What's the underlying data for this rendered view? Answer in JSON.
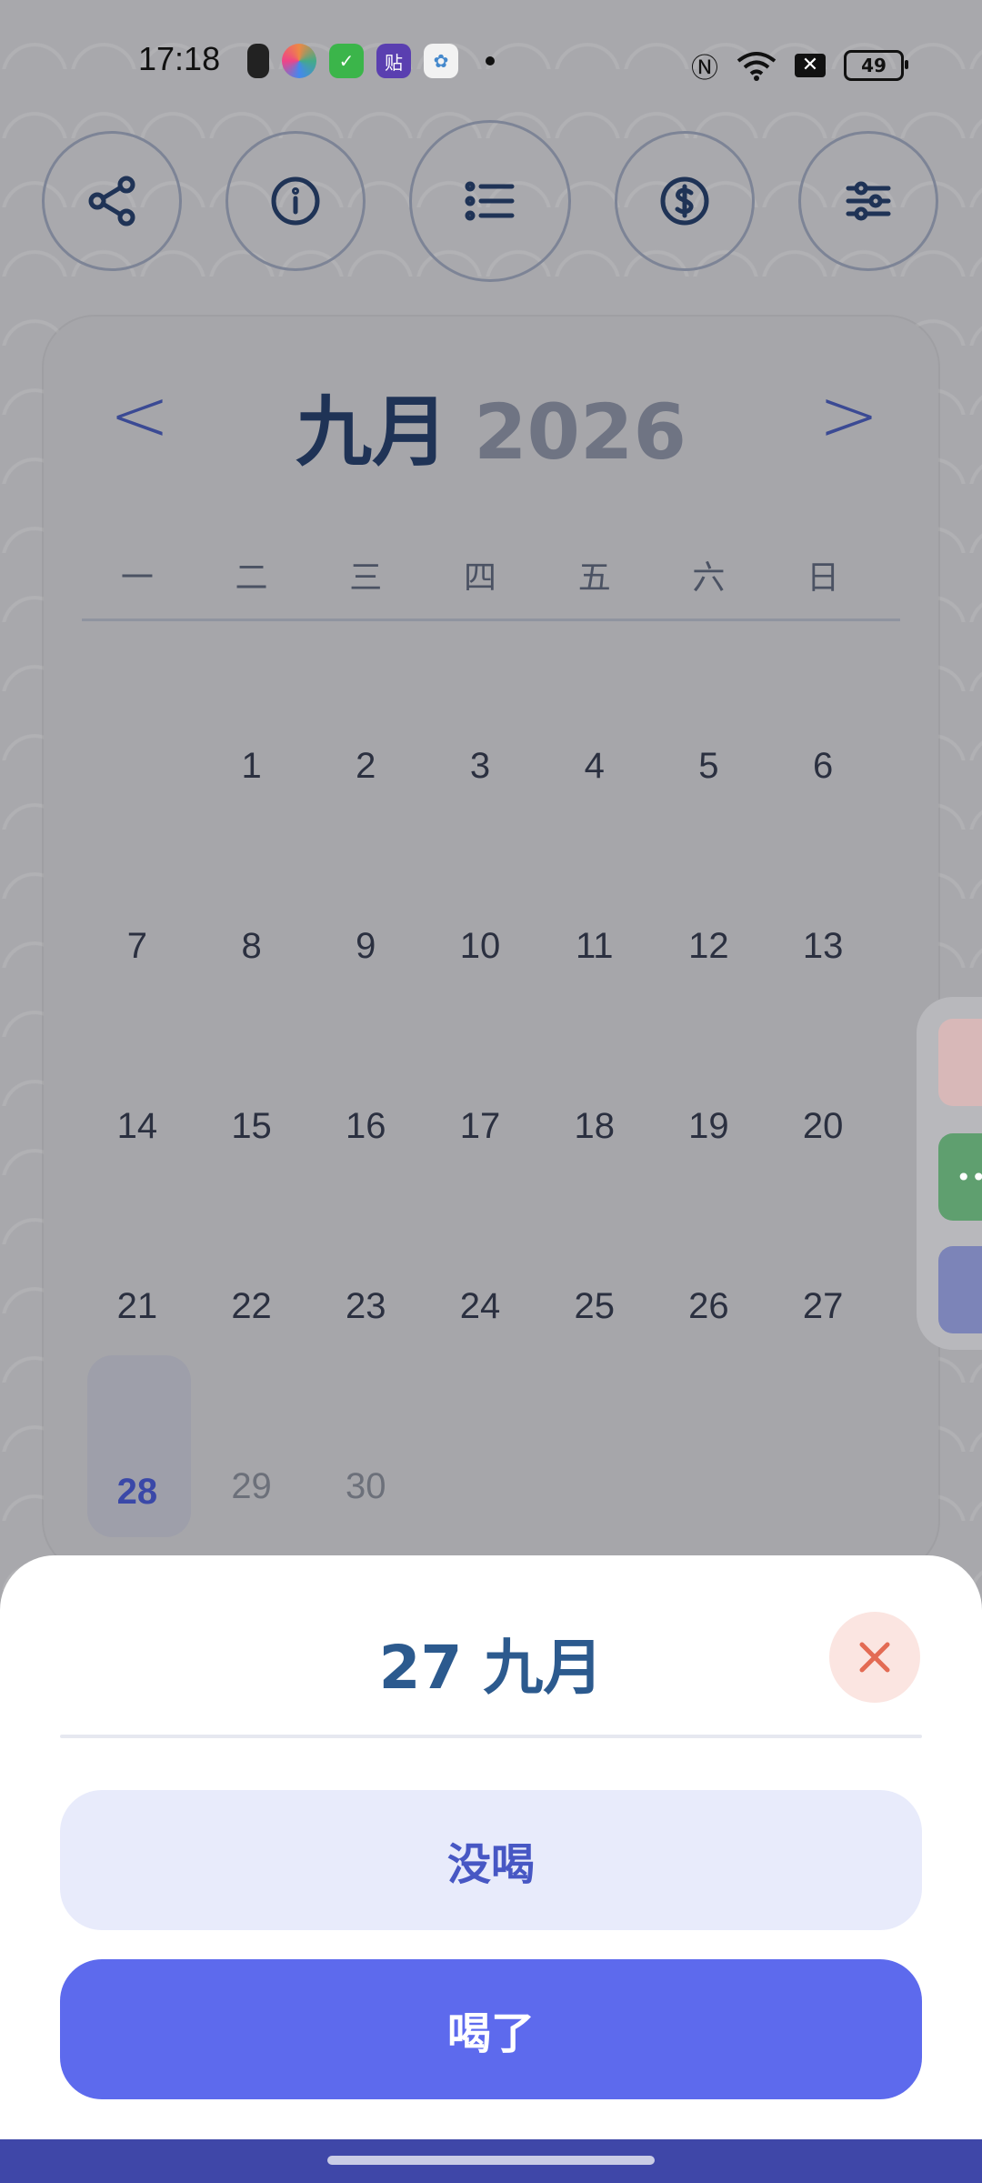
{
  "status_bar": {
    "time": "17:18",
    "battery": "49",
    "icons": [
      "cup-icon",
      "color-wheel-icon",
      "shield-icon",
      "tie-icon",
      "cloud-icon",
      "nfc-icon",
      "wifi-icon",
      "no-sim-icon",
      "battery-icon"
    ]
  },
  "toolbar": {
    "buttons": [
      "share-icon",
      "info-icon",
      "list-icon",
      "dollar-icon",
      "sliders-icon"
    ]
  },
  "calendar": {
    "month": "九月",
    "year": "2026",
    "prev": "<",
    "next": ">",
    "weekdays": [
      "一",
      "二",
      "三",
      "四",
      "五",
      "六",
      "日"
    ],
    "today": "28",
    "days": [
      "1",
      "2",
      "3",
      "4",
      "5",
      "6",
      "7",
      "8",
      "9",
      "10",
      "11",
      "12",
      "13",
      "14",
      "15",
      "16",
      "17",
      "18",
      "19",
      "20",
      "21",
      "22",
      "23",
      "24",
      "25",
      "26",
      "27",
      "29",
      "30"
    ]
  },
  "sheet": {
    "title": "27 九月",
    "no_label": "没喝",
    "yes_label": "喝了"
  },
  "side_panel": {
    "apps": [
      "avatar-app",
      "chat-app",
      "cat-app"
    ],
    "dots": "••"
  },
  "colors": {
    "accent": "#5d6aed",
    "title_blue": "#2c5a8e",
    "close_red": "#e36b54"
  }
}
